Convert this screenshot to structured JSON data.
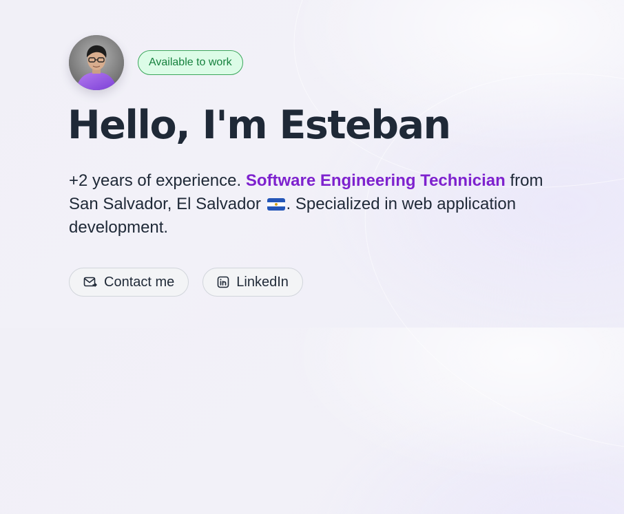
{
  "profile": {
    "avatar_alt": "Profile photo of Esteban",
    "availability_badge": "Available to work",
    "heading": "Hello, I'm Esteban"
  },
  "bio": {
    "part1": "+2 years of experience. ",
    "role": "Software Engineering Technician",
    "part2": " from San Salvador, El Salvador ",
    "flag_icon": "el-salvador-flag-icon",
    "part3": ". Specialized in web application development."
  },
  "actions": {
    "contact_label": "Contact me",
    "contact_icon": "mail-icon",
    "linkedin_label": "LinkedIn",
    "linkedin_icon": "linkedin-icon"
  },
  "colors": {
    "accent": "#7e22ce",
    "badge_bg": "#dcfce7",
    "badge_text": "#15803d",
    "text": "#1f2937",
    "background": "#f1f0f7"
  }
}
